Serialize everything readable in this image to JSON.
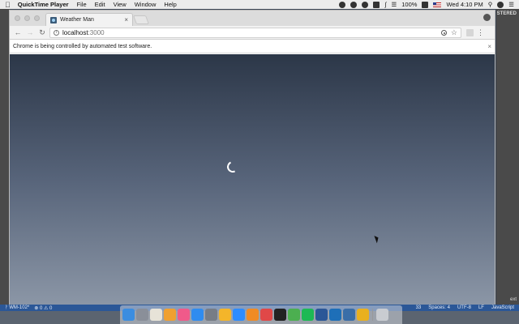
{
  "menubar": {
    "app_name": "QuickTime Player",
    "items": [
      "File",
      "Edit",
      "View",
      "Window",
      "Help"
    ],
    "battery": "100%",
    "clock": "Wed 4:10 PM"
  },
  "desktop": {
    "right_strip_text": "STERED",
    "right_strip_bottom": "ext"
  },
  "browser": {
    "tab_title": "Weather Man",
    "tab_close": "×",
    "address_host": "localhost",
    "address_port": ":3000",
    "infobar_text": "Chrome is being controlled by automated test software.",
    "infobar_close": "×"
  },
  "statusbar": {
    "branch": "ᚹ WM-102*",
    "problems": "⊗ 0 ⚠ 0",
    "line": "33",
    "spaces": "Spaces: 4",
    "encoding": "UTF-8",
    "eol": "LF",
    "language": "JavaScript"
  },
  "dock": {
    "apps": [
      {
        "name": "finder",
        "color": "#3b8de0"
      },
      {
        "name": "launchpad",
        "color": "#8a8f99"
      },
      {
        "name": "notes",
        "color": "#e7e3d8"
      },
      {
        "name": "photos",
        "color": "#f0a030"
      },
      {
        "name": "itunes",
        "color": "#f05a8a"
      },
      {
        "name": "app-store",
        "color": "#2f8cf0"
      },
      {
        "name": "system-preferences",
        "color": "#777d86"
      },
      {
        "name": "stickies",
        "color": "#f4b52a"
      },
      {
        "name": "zoom",
        "color": "#2d8cff"
      },
      {
        "name": "sublime-text",
        "color": "#f08b24"
      },
      {
        "name": "sourcetree",
        "color": "#e04848"
      },
      {
        "name": "terminal",
        "color": "#222222"
      },
      {
        "name": "chrome",
        "color": "#4caf50"
      },
      {
        "name": "spotify",
        "color": "#1db954"
      },
      {
        "name": "word",
        "color": "#2b5797"
      },
      {
        "name": "vscode",
        "color": "#1e6fb8"
      },
      {
        "name": "quicktime",
        "color": "#3a6ea8"
      },
      {
        "name": "chrome-canary",
        "color": "#e9b01f"
      },
      {
        "name": "trash",
        "color": "#c9ccd1"
      }
    ]
  }
}
